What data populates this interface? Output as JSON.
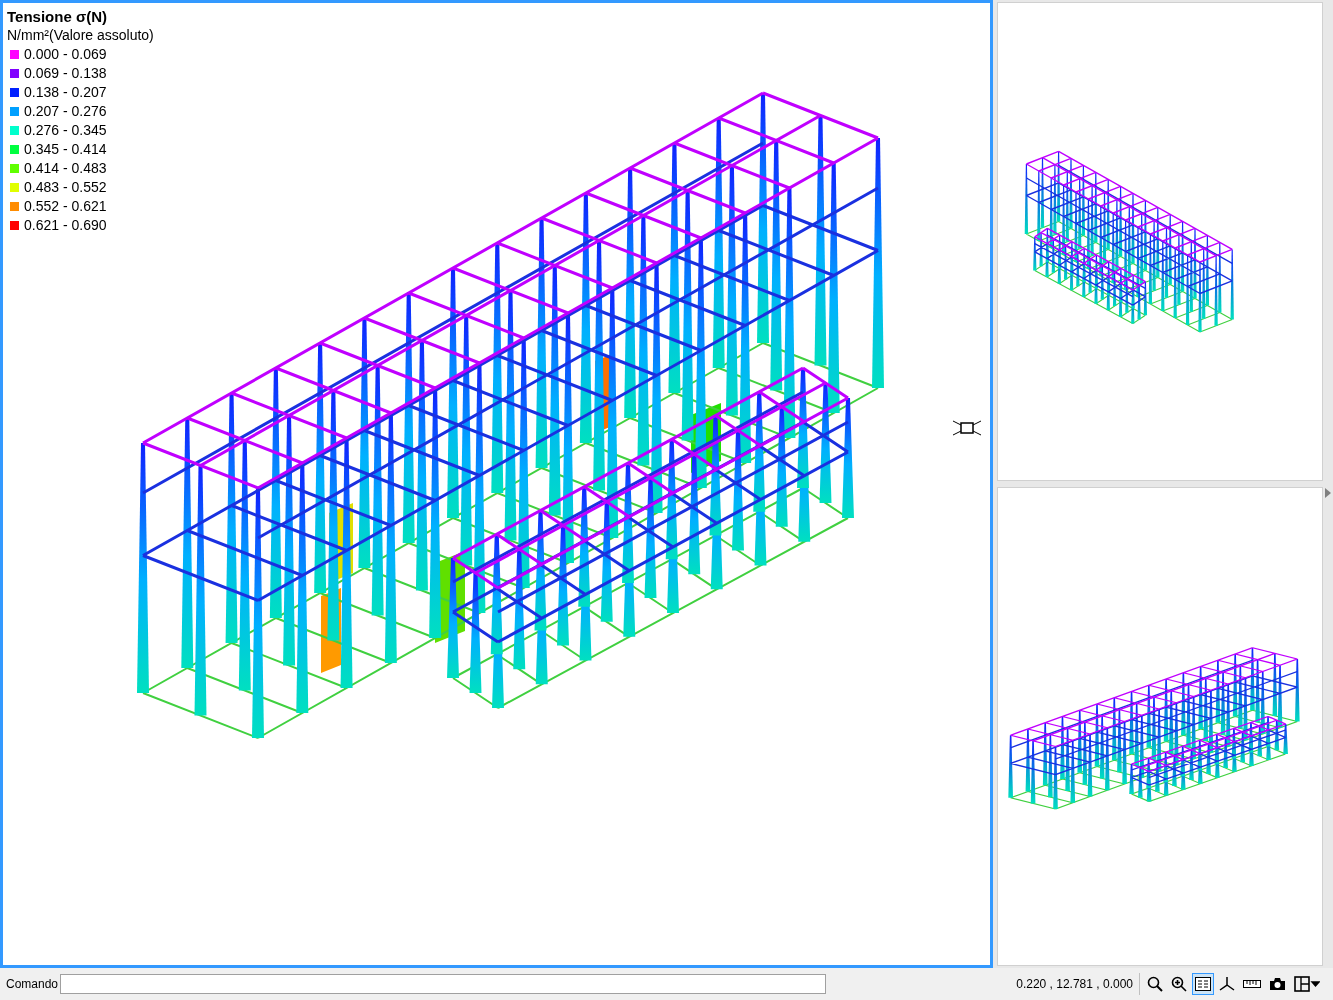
{
  "legend": {
    "title": "Tensione σ(N)",
    "unit": "N/mm²(Valore assoluto)",
    "items": [
      {
        "range": "0.000 - 0.069",
        "color": "#ff00ff"
      },
      {
        "range": "0.069 - 0.138",
        "color": "#8000ff"
      },
      {
        "range": "0.138 - 0.207",
        "color": "#0020ff"
      },
      {
        "range": "0.207 - 0.276",
        "color": "#00a0ff"
      },
      {
        "range": "0.276 - 0.345",
        "color": "#00ffcc"
      },
      {
        "range": "0.345 - 0.414",
        "color": "#00ff40"
      },
      {
        "range": "0.414 - 0.483",
        "color": "#60ff00"
      },
      {
        "range": "0.483 - 0.552",
        "color": "#e0ff00"
      },
      {
        "range": "0.552 - 0.621",
        "color": "#ff8c00"
      },
      {
        "range": "0.621 - 0.690",
        "color": "#ff0000"
      }
    ]
  },
  "command_bar": {
    "label": "Comando"
  },
  "status": {
    "coordinates": "0.220 , 12.781 , 0.000"
  },
  "toolbar": [
    {
      "kind": "zoom",
      "selected": false
    },
    {
      "kind": "zoom-extents",
      "selected": false
    },
    {
      "kind": "properties",
      "selected": true
    },
    {
      "kind": "axes",
      "selected": false
    },
    {
      "kind": "ruler",
      "selected": false
    },
    {
      "kind": "camera",
      "selected": false
    },
    {
      "kind": "layout",
      "selected": false
    }
  ]
}
